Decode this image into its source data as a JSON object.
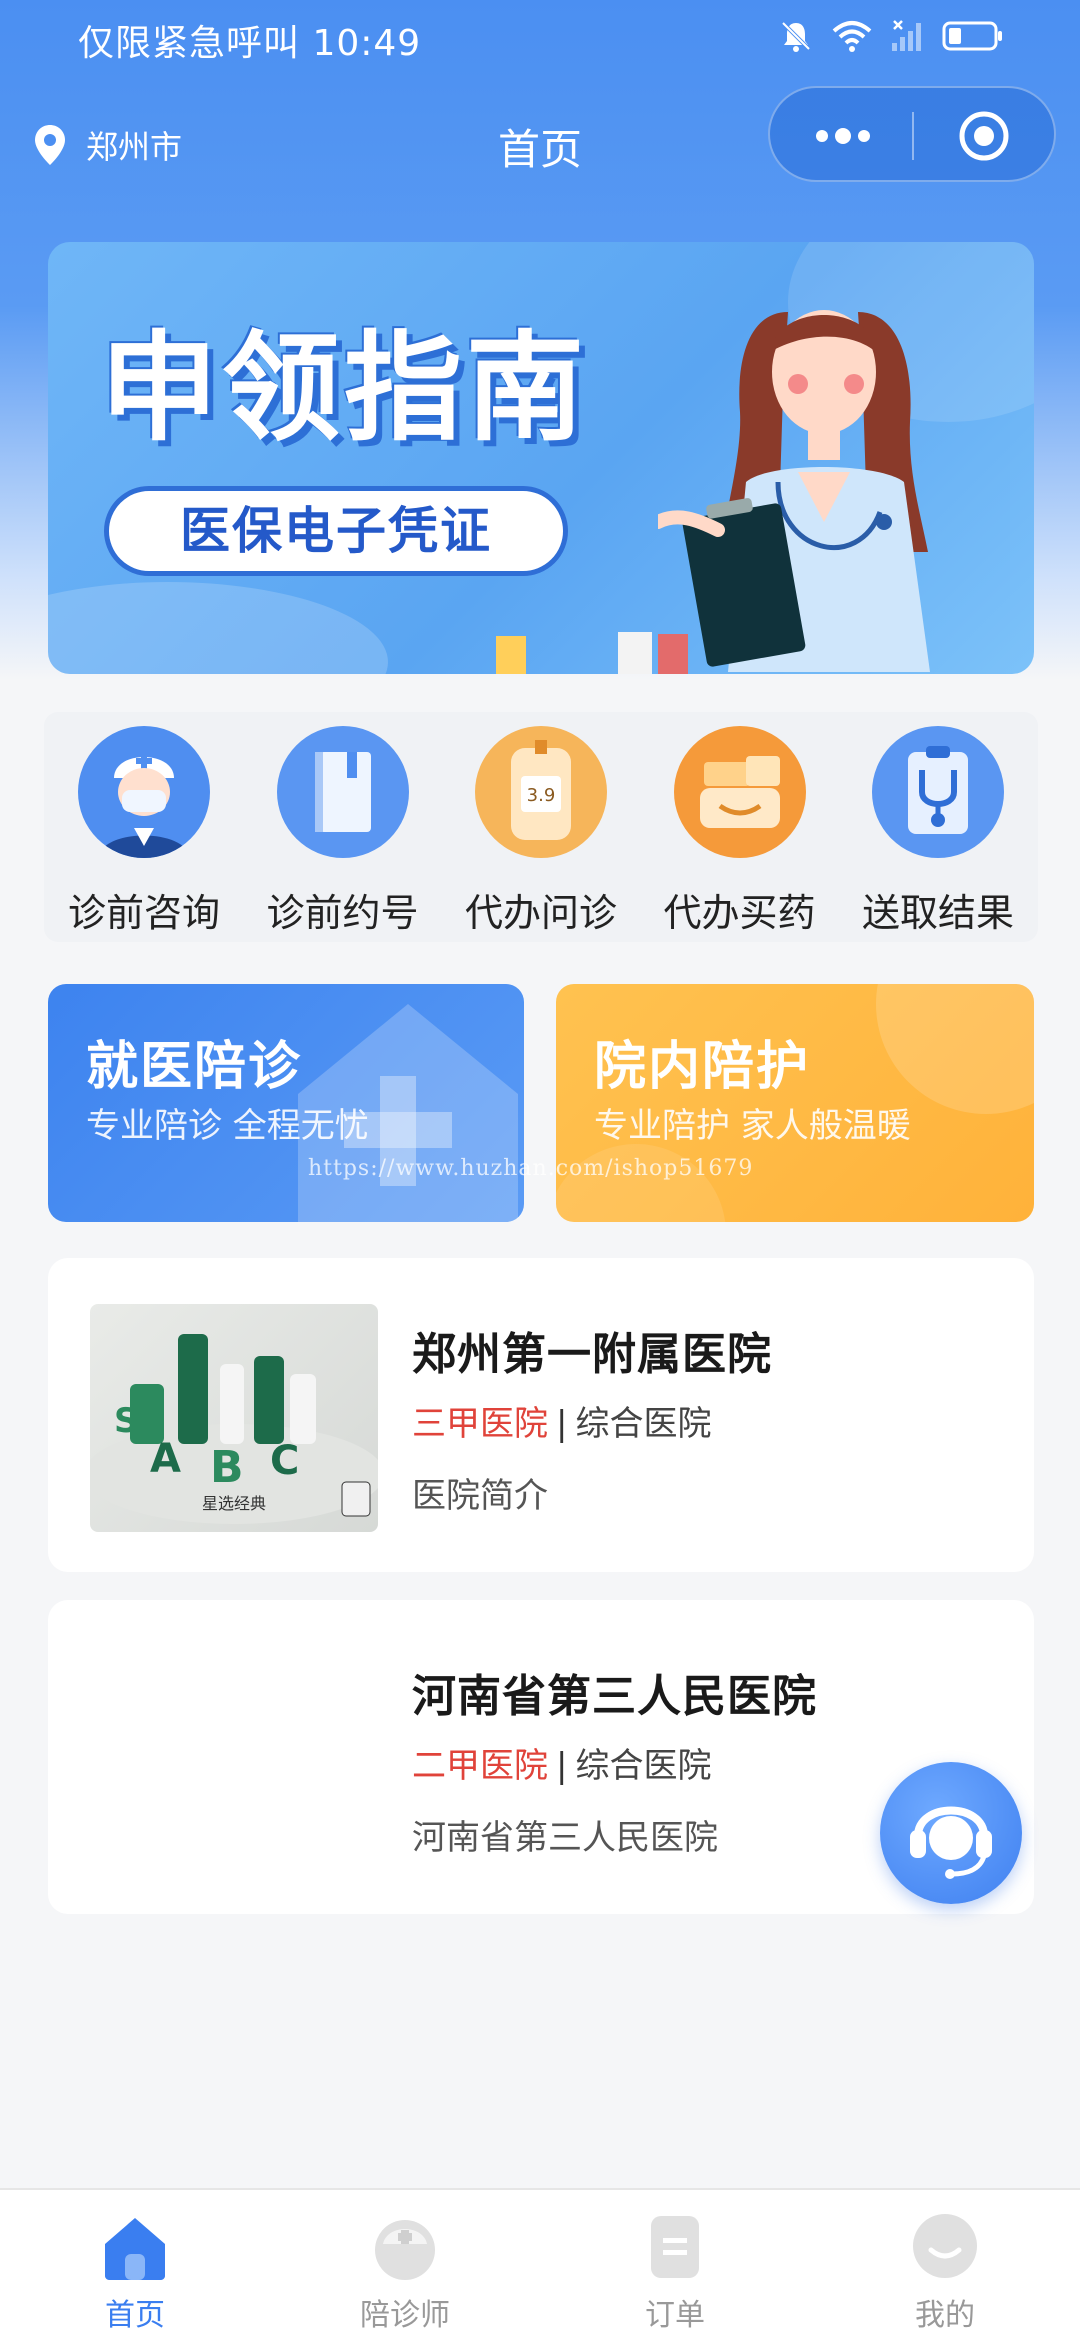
{
  "status_bar": {
    "text": "仅限紧急呼叫 10:49"
  },
  "nav": {
    "location": "郑州市",
    "title": "首页"
  },
  "banner": {
    "title": "申领指南",
    "subtitle": "医保电子凭证"
  },
  "services": [
    {
      "label": "诊前咨询",
      "icon": "doctor-icon"
    },
    {
      "label": "诊前约号",
      "icon": "book-icon"
    },
    {
      "label": "代办问诊",
      "icon": "blood-glucose-meter-icon"
    },
    {
      "label": "代办买药",
      "icon": "pharmacy-icon"
    },
    {
      "label": "送取结果",
      "icon": "stethoscope-clipboard-icon"
    }
  ],
  "promos": [
    {
      "title": "就医陪诊",
      "subtitle": "专业陪诊 全程无忧"
    },
    {
      "title": "院内陪护",
      "subtitle": "专业陪护 家人般温暖"
    }
  ],
  "watermark": "https://www.huzhan.com/ishop51679",
  "hospitals": [
    {
      "name": "郑州第一附属医院",
      "level": "三甲医院",
      "separator": "|",
      "type": "综合医院",
      "desc": "医院简介",
      "thumb_caption": "星选经典"
    },
    {
      "name": "河南省第三人民医院",
      "level": "二甲医院",
      "separator": "|",
      "type": "综合医院",
      "desc": "河南省第三人民医院"
    }
  ],
  "tabbar": [
    {
      "label": "首页",
      "active": true
    },
    {
      "label": "陪诊师",
      "active": false
    },
    {
      "label": "订单",
      "active": false
    },
    {
      "label": "我的",
      "active": false
    }
  ],
  "colors": {
    "primary": "#3a7ef0",
    "level_red": "#e0433a",
    "orange": "#ffb23a"
  }
}
